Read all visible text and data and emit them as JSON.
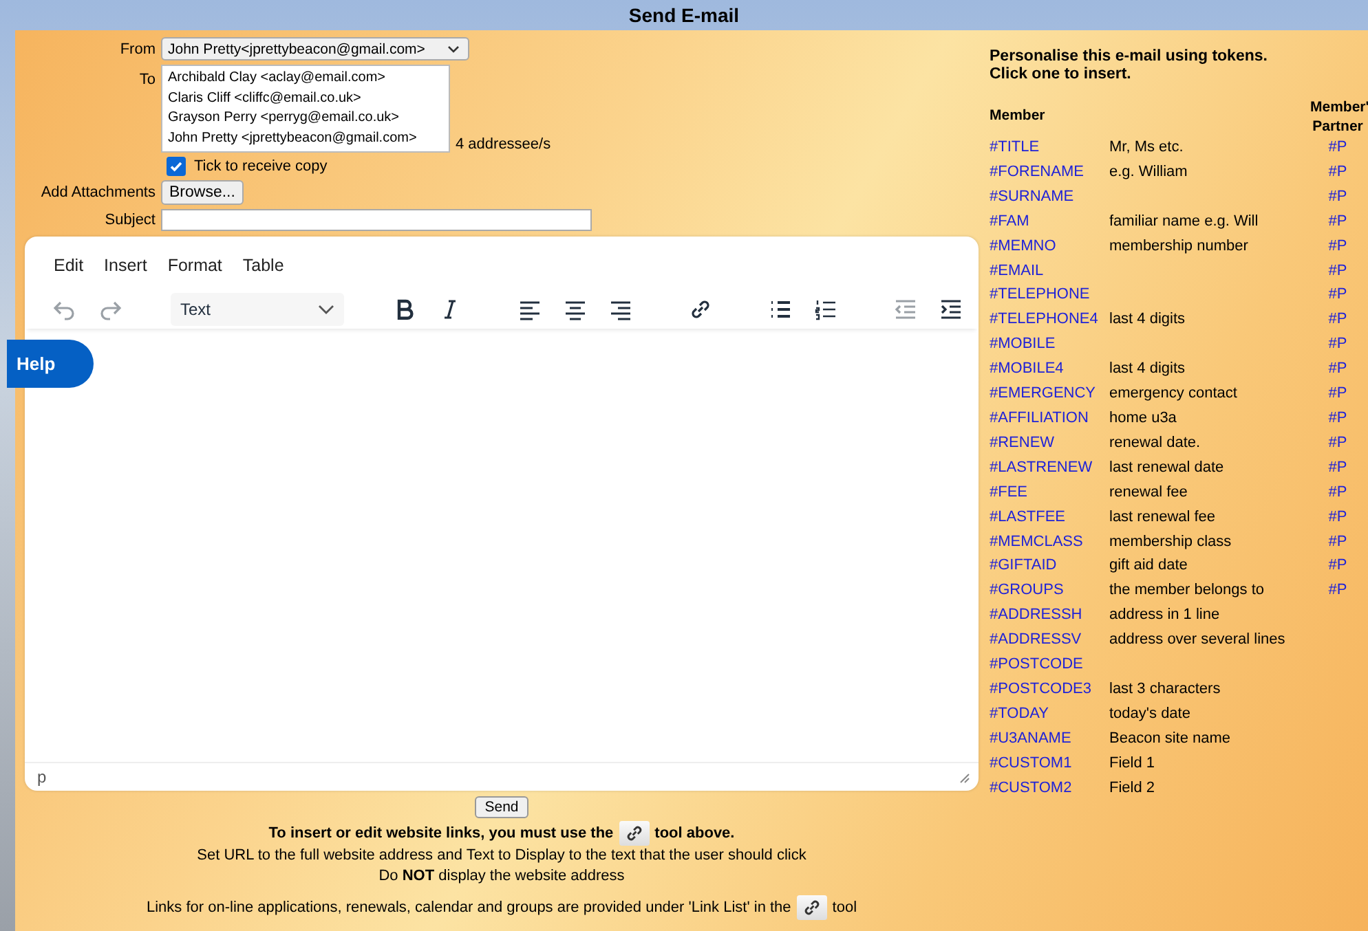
{
  "page_title": "Send E-mail",
  "form": {
    "from_label": "From",
    "from_value": "John Pretty<jprettybeacon@gmail.com>",
    "to_label": "To",
    "recipients": [
      {
        "text": "Archibald Clay <aclay@email.com>"
      },
      {
        "text": "Claris Cliff <cliffc@email.co.uk>"
      },
      {
        "text": "Grayson Perry <perryg@email.co.uk>"
      },
      {
        "text": "John Pretty <jprettybeacon@gmail.com>"
      }
    ],
    "addressee_count": "4 addressee/s",
    "copy_label": "Tick to receive copy",
    "copy_checked": true,
    "attachments_label": "Add Attachments",
    "browse_button": "Browse...",
    "subject_label": "Subject"
  },
  "editor": {
    "menu": [
      "Edit",
      "Insert",
      "Format",
      "Table"
    ],
    "toolbar": [
      {
        "kind": "undo",
        "disabled": true
      },
      {
        "kind": "redo",
        "disabled": true
      },
      {
        "kind": "format-select",
        "label": "Text"
      },
      {
        "kind": "bold",
        "disabled": false
      },
      {
        "kind": "italic",
        "disabled": false
      },
      {
        "kind": "align-left",
        "disabled": false
      },
      {
        "kind": "align-center",
        "disabled": false
      },
      {
        "kind": "align-right",
        "disabled": false
      },
      {
        "kind": "link",
        "disabled": false
      },
      {
        "kind": "bullet-list",
        "disabled": false
      },
      {
        "kind": "numbered-list",
        "disabled": false
      },
      {
        "kind": "outdent",
        "disabled": true
      },
      {
        "kind": "indent",
        "disabled": false
      }
    ],
    "status_path": "p"
  },
  "help_tab": "Help",
  "send_button": "Send",
  "instructions": {
    "link_line_before": "To insert or edit website links, you must use the",
    "link_line_after": "tool above.",
    "url_line": "Set URL to the full website address and Text to Display to the text that the user should click",
    "warning_line": "Do **NOT** display the website address",
    "list_line_before": "Links for on-line applications, renewals, calendar and groups are provided under 'Link List' in the",
    "list_line_after": "tool"
  },
  "tokens": {
    "intro": [
      "Personalise this e-mail using tokens.",
      "Click one to insert."
    ],
    "member_header": "Member",
    "partner_header": [
      "Member'",
      "Partner"
    ],
    "rows": [
      {
        "token": "#TITLE",
        "description": "Mr, Ms etc.",
        "partner": "#P"
      },
      {
        "token": "#FORENAME",
        "description": "e.g. William",
        "partner": "#P"
      },
      {
        "token": "#SURNAME",
        "partner": "#P"
      },
      {
        "token": "#FAM",
        "description": "familiar name e.g. Will",
        "partner": "#P"
      },
      {
        "token": "#MEMNO",
        "description": "membership number",
        "partner": "#P"
      },
      {
        "token": "#EMAIL",
        "partner": "#P"
      },
      {
        "token": "#TELEPHONE",
        "partner": "#P"
      },
      {
        "token": "#TELEPHONE4",
        "description": "last 4 digits",
        "partner": "#P"
      },
      {
        "token": "#MOBILE",
        "partner": "#P"
      },
      {
        "token": "#MOBILE4",
        "description": "last 4 digits",
        "partner": "#P"
      },
      {
        "token": "#EMERGENCY",
        "description": "emergency contact",
        "partner": "#P"
      },
      {
        "token": "#AFFILIATION",
        "description": "home u3a",
        "partner": "#P"
      },
      {
        "token": "#RENEW",
        "description": "renewal date.",
        "partner": "#P"
      },
      {
        "token": "#LASTRENEW",
        "description": "last renewal date",
        "partner": "#P"
      },
      {
        "token": "#FEE",
        "description": "renewal fee",
        "partner": "#P"
      },
      {
        "token": "#LASTFEE",
        "description": "last renewal fee",
        "partner": "#P"
      },
      {
        "token": "#MEMCLASS",
        "description": "membership class",
        "partner": "#P"
      },
      {
        "token": "#GIFTAID",
        "description": "gift aid date",
        "partner": "#P"
      },
      {
        "token": "#GROUPS",
        "description": "the member belongs to",
        "partner": "#P"
      },
      {
        "token": "#ADDRESSH",
        "description": "address in 1 line"
      },
      {
        "token": "#ADDRESSV",
        "description": "address over several lines"
      },
      {
        "token": "#POSTCODE"
      },
      {
        "token": "#POSTCODE3",
        "description": "last 3 characters"
      },
      {
        "token": "#TODAY",
        "description": "today's date"
      },
      {
        "token": "#U3ANAME",
        "description": "Beacon site name"
      },
      {
        "token": "#CUSTOM1",
        "description": "Field 1"
      },
      {
        "token": "#CUSTOM2",
        "description": "Field 2"
      }
    ]
  }
}
